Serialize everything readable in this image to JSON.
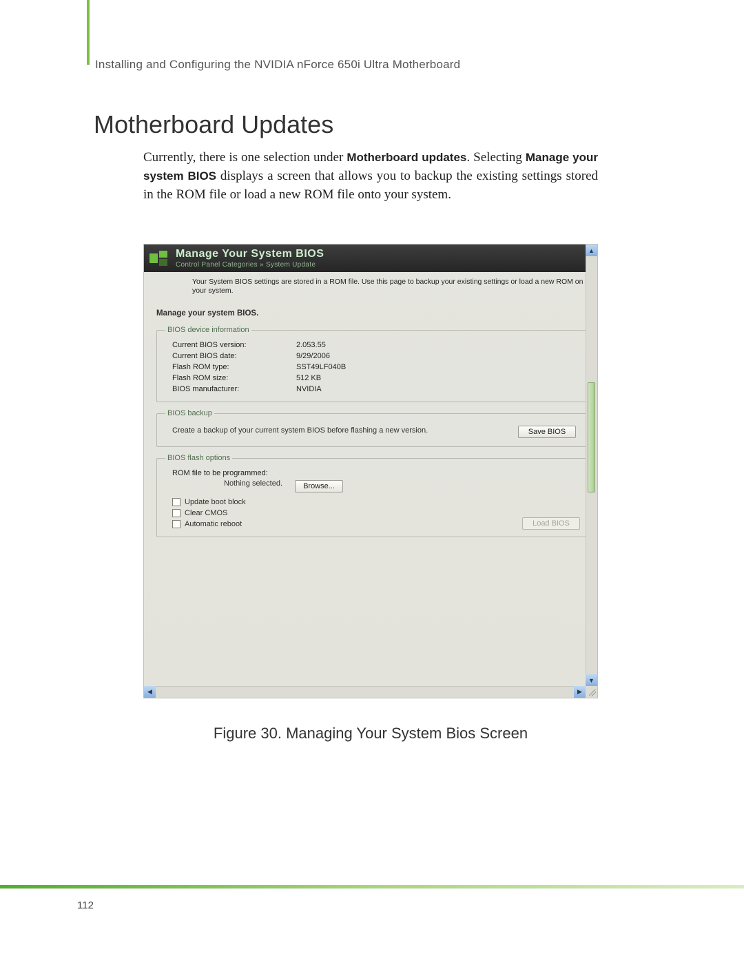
{
  "header_path": "Installing and Configuring the NVIDIA nForce 650i Ultra Motherboard",
  "section_title": "Motherboard Updates",
  "body": {
    "line1_pre": "Currently, there is one selection under ",
    "line1_bold": "Motherboard updates",
    "line1_post": ". Selecting ",
    "line2_bold": "Manage your system BIOS",
    "line2_post": " displays a screen that allows you to backup the existing settings stored in the ROM file or load a new ROM file onto your system."
  },
  "panel": {
    "title": "Manage Your System BIOS",
    "breadcrumb": "Control Panel Categories » System Update",
    "intro": "Your System BIOS settings are stored in a ROM file.  Use this page to backup your existing settings or load a new ROM on your system.",
    "section_label": "Manage your system BIOS.",
    "device_info": {
      "legend": "BIOS device information",
      "rows": [
        {
          "label": "Current BIOS version:",
          "value": "2.053.55"
        },
        {
          "label": "Current BIOS date:",
          "value": "9/29/2006"
        },
        {
          "label": "Flash ROM type:",
          "value": "SST49LF040B"
        },
        {
          "label": "Flash ROM size:",
          "value": "512 KB"
        },
        {
          "label": "BIOS manufacturer:",
          "value": "NVIDIA"
        }
      ]
    },
    "backup": {
      "legend": "BIOS backup",
      "text": "Create a backup of your current system BIOS before flashing a new version.",
      "save_btn": "Save BIOS"
    },
    "flash": {
      "legend": "BIOS flash options",
      "rom_label": "ROM file to be programmed:",
      "rom_value": "Nothing selected.",
      "browse_btn": "Browse...",
      "cb1": "Update boot block",
      "cb2": "Clear CMOS",
      "cb3": "Automatic reboot",
      "load_btn": "Load BIOS"
    }
  },
  "figure_caption": "Figure 30.    Managing Your System Bios Screen",
  "page_number": "112"
}
